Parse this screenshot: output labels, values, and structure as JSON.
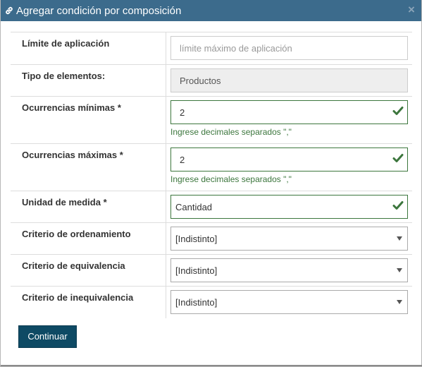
{
  "header": {
    "title": "Agregar condición por composición",
    "close_symbol": "×",
    "icons": {
      "title_icon": "link-icon",
      "close_icon": "close-icon"
    }
  },
  "form": {
    "rows": [
      {
        "label": "Límite de aplicación",
        "value": "",
        "placeholder": "límite máximo de aplicación"
      },
      {
        "label": "Tipo de elementos:",
        "value": "Productos"
      },
      {
        "label": "Ocurrencias mínimas *",
        "value": "2",
        "help": "Ingrese decimales separados \",\""
      },
      {
        "label": "Ocurrencias máximas *",
        "value": "2",
        "help": "Ingrese decimales separados \",\""
      },
      {
        "label": "Unidad de medida *",
        "value": "Cantidad"
      },
      {
        "label": "Criterio de ordenamiento",
        "value": "[Indistinto]"
      },
      {
        "label": "Criterio de equivalencia",
        "value": "[Indistinto]"
      },
      {
        "label": "Criterio de inequivalencia",
        "value": "[Indistinto]"
      }
    ]
  },
  "actions": {
    "continue_label": "Continuar"
  },
  "colors": {
    "header_bg": "#3c6b8c",
    "valid": "#3c763d",
    "button_bg": "#0e4a64"
  }
}
